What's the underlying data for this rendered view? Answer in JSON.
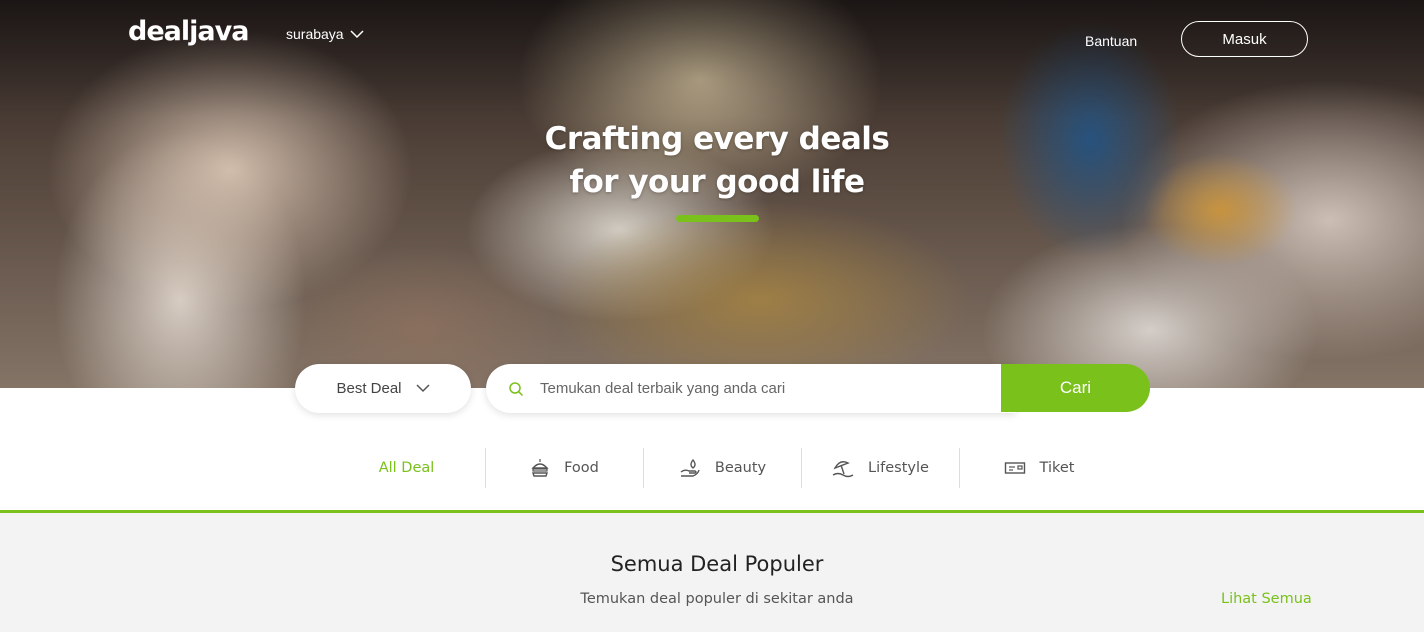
{
  "brand": {
    "name": "dealjava",
    "accent": "#7ac11c"
  },
  "header": {
    "city": "surabaya",
    "help_label": "Bantuan",
    "login_label": "Masuk"
  },
  "hero": {
    "line1": "Crafting every deals",
    "line2": "for your good life"
  },
  "search": {
    "deal_type": "Best Deal",
    "placeholder": "Temukan deal terbaik yang anda cari",
    "button_label": "Cari"
  },
  "categories": [
    {
      "label": "All Deal",
      "icon": "",
      "active": true
    },
    {
      "label": "Food",
      "icon": "food-icon"
    },
    {
      "label": "Beauty",
      "icon": "beauty-icon"
    },
    {
      "label": "Lifestyle",
      "icon": "lifestyle-icon"
    },
    {
      "label": "Tiket",
      "icon": "ticket-icon"
    }
  ],
  "popular": {
    "title": "Semua Deal Populer",
    "subtitle": "Temukan deal populer di sekitar anda",
    "see_all_label": "Lihat Semua"
  }
}
